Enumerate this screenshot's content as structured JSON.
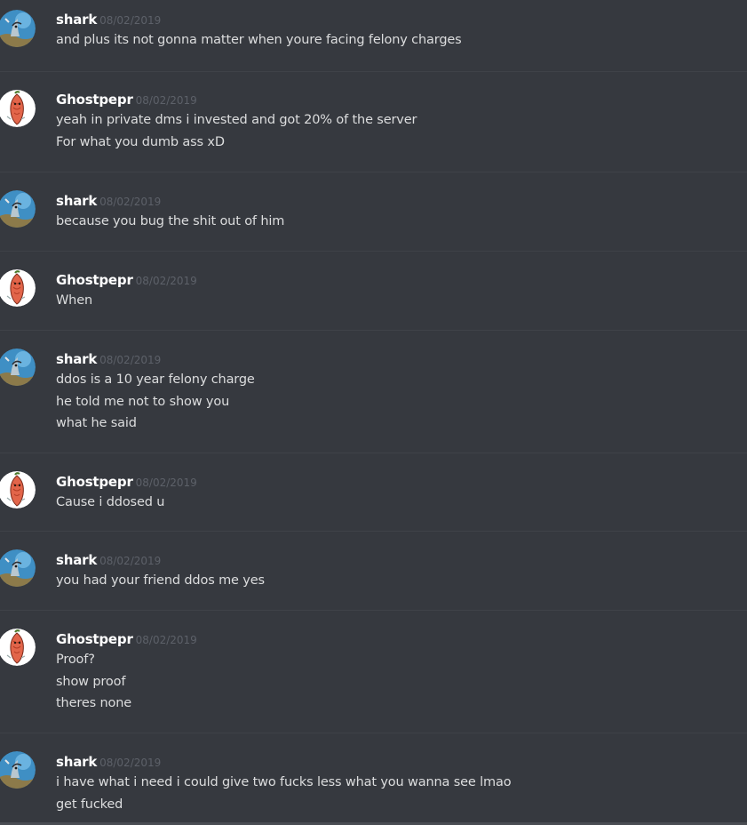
{
  "messages": [
    {
      "author": "shark",
      "avatar": "shark-avatar-icon",
      "timestamp": "08/02/2019",
      "lines": [
        "and plus its not gonna matter when youre facing felony charges"
      ]
    },
    {
      "author": "Ghostpepr",
      "avatar": "pepper-avatar-icon",
      "timestamp": "08/02/2019",
      "lines": [
        "yeah in private dms i invested and got 20% of the server",
        "For what you dumb ass xD"
      ]
    },
    {
      "author": "shark",
      "avatar": "shark-avatar-icon",
      "timestamp": "08/02/2019",
      "lines": [
        "because you bug the shit out of him"
      ]
    },
    {
      "author": "Ghostpepr",
      "avatar": "pepper-avatar-icon",
      "timestamp": "08/02/2019",
      "lines": [
        "When"
      ]
    },
    {
      "author": "shark",
      "avatar": "shark-avatar-icon",
      "timestamp": "08/02/2019",
      "lines": [
        "ddos is a 10 year felony charge",
        "he told me not to show you",
        "what he said"
      ]
    },
    {
      "author": "Ghostpepr",
      "avatar": "pepper-avatar-icon",
      "timestamp": "08/02/2019",
      "lines": [
        "Cause i ddosed u"
      ]
    },
    {
      "author": "shark",
      "avatar": "shark-avatar-icon",
      "timestamp": "08/02/2019",
      "lines": [
        "you had your friend ddos me yes"
      ]
    },
    {
      "author": "Ghostpepr",
      "avatar": "pepper-avatar-icon",
      "timestamp": "08/02/2019",
      "lines": [
        "Proof?",
        "show proof",
        "theres none"
      ]
    },
    {
      "author": "shark",
      "avatar": "shark-avatar-icon",
      "timestamp": "08/02/2019",
      "lines": [
        "i have what i need i could give two fucks less what you wanna see lmao",
        "get fucked"
      ]
    }
  ],
  "colors": {
    "background": "#36393f",
    "divider": "#3f4248",
    "username": "#ffffff",
    "timestamp": "#5d6169",
    "message_text": "#dcddde"
  }
}
